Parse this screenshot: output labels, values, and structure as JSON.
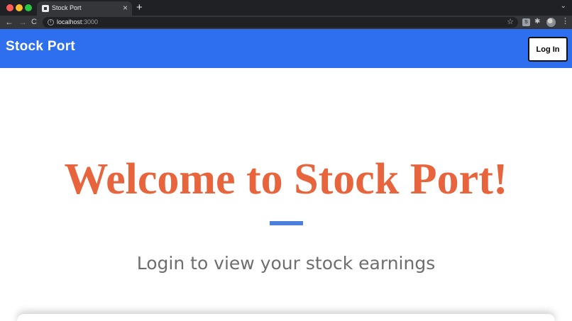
{
  "browser": {
    "tab_title": "Stock Port",
    "tab_close": "×",
    "new_tab": "+",
    "tabs_menu": "⌄",
    "nav_back": "←",
    "nav_forward": "→",
    "nav_reload": "C",
    "url_host": "localhost",
    "url_port": ":3000",
    "info": "i",
    "star": "☆",
    "ext_s": "S",
    "ext_puzzle": "✱",
    "kebab": "⋮"
  },
  "navbar": {
    "brand": "Stock Port",
    "login_label": "Log In",
    "color": "#2e6ff0"
  },
  "hero": {
    "title": "Welcome to Stock Port!",
    "subtitle": "Login to view your stock earnings",
    "title_color": "#e8643c",
    "divider_color": "#4a7fdc"
  }
}
